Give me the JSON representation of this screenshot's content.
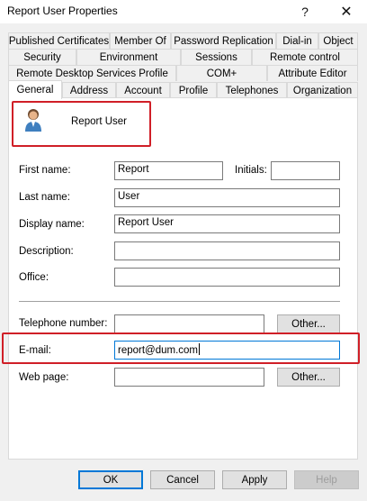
{
  "window": {
    "title": "Report User Properties",
    "help_glyph": "?",
    "close_glyph": "✕"
  },
  "tabs": {
    "row1": [
      "Published Certificates",
      "Member Of",
      "Password Replication",
      "Dial-in",
      "Object"
    ],
    "row2": [
      "Security",
      "Environment",
      "Sessions",
      "Remote control"
    ],
    "row3": [
      "Remote Desktop Services Profile",
      "COM+",
      "Attribute Editor"
    ],
    "row4": [
      "General",
      "Address",
      "Account",
      "Profile",
      "Telephones",
      "Organization"
    ],
    "active": "General"
  },
  "general": {
    "user_name": "Report User",
    "first_name_label": "First name:",
    "first_name_value": "Report",
    "initials_label": "Initials:",
    "initials_value": "",
    "last_name_label": "Last name:",
    "last_name_value": "User",
    "display_name_label": "Display name:",
    "display_name_value": "Report User",
    "description_label": "Description:",
    "description_value": "",
    "office_label": "Office:",
    "office_value": "",
    "telephone_label": "Telephone number:",
    "telephone_value": "",
    "email_label": "E-mail:",
    "email_value": "report@dum.com",
    "webpage_label": "Web page:",
    "webpage_value": "",
    "other_label": "Other..."
  },
  "footer": {
    "ok": "OK",
    "cancel": "Cancel",
    "apply": "Apply",
    "help": "Help"
  },
  "colors": {
    "highlight_border": "#d01f27",
    "focus_border": "#0078d7",
    "dialog_bg": "#f0f0f0"
  }
}
